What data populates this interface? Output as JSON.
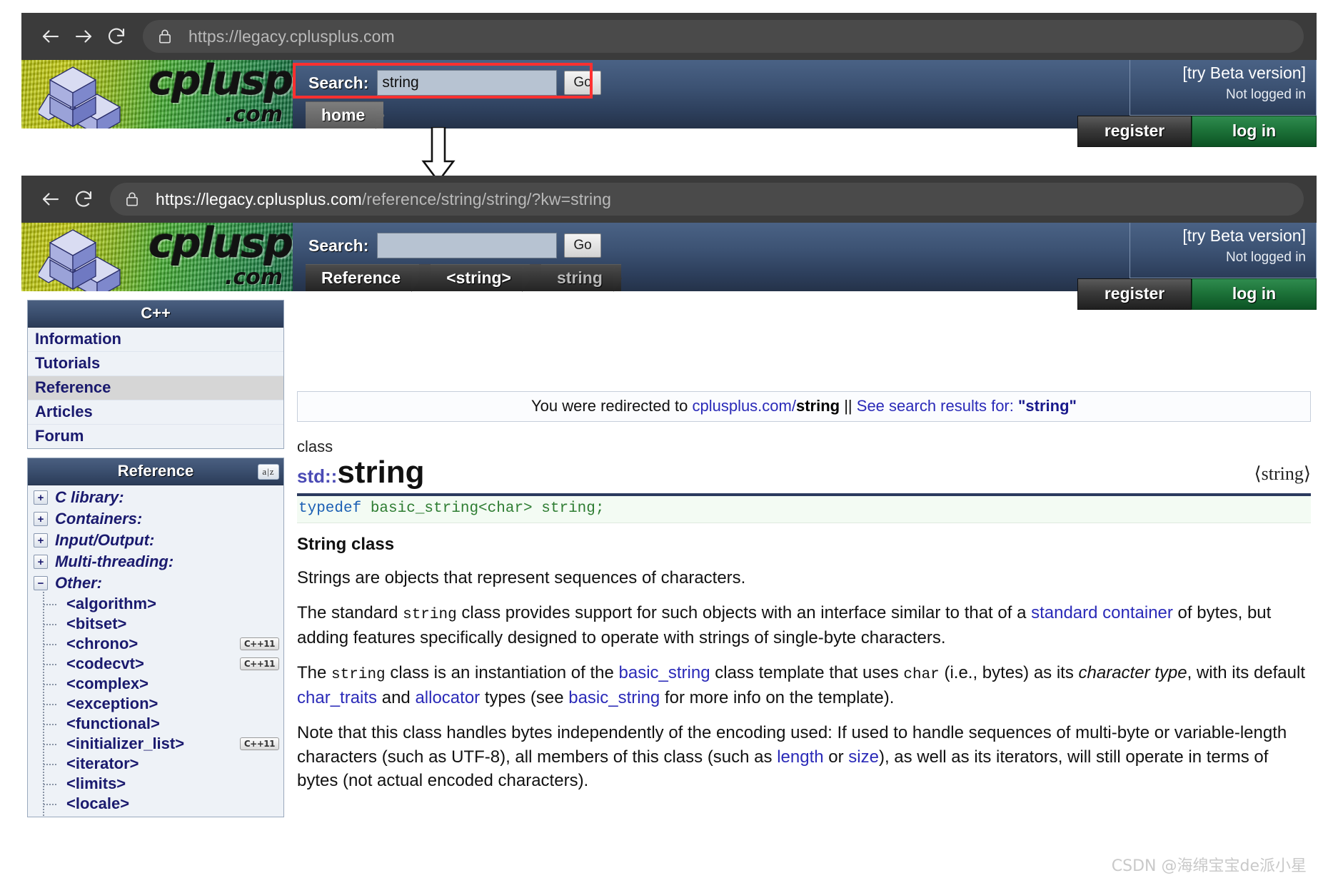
{
  "window_top": {
    "nav": {
      "back": "←",
      "forward": "→",
      "reload": "⟳",
      "lock_icon": "lock-icon"
    },
    "url_full": "https://legacy.cplusplus.com",
    "url_domain": "https://legacy.cplusplus.com",
    "url_path": "",
    "search_label": "Search:",
    "search_value": "string",
    "search_placeholder": "",
    "go_label": "Go",
    "beta_label": "[try Beta version]",
    "login_status": "Not logged in",
    "register_label": "register",
    "login_label": "log in",
    "logo_word": "cplusplus",
    "logo_dotcom": ".com",
    "crumb_home": "home"
  },
  "window_bottom": {
    "nav": {
      "back": "←",
      "reload": "⟳",
      "lock_icon": "lock-icon"
    },
    "url_domain": "https://legacy.cplusplus.com",
    "url_path": "/reference/string/string/?kw=string",
    "search_label": "Search:",
    "search_value": "",
    "search_placeholder": "",
    "go_label": "Go",
    "beta_label": "[try Beta version]",
    "login_status": "Not logged in",
    "register_label": "register",
    "login_label": "log in",
    "logo_word": "cplusplus",
    "logo_dotcom": ".com",
    "breadcrumbs": [
      "Reference",
      "<string>",
      "string"
    ]
  },
  "sidebar": {
    "cpp_panel_title": "C++",
    "cpp_menu": [
      {
        "label": "Information",
        "selected": false
      },
      {
        "label": "Tutorials",
        "selected": false
      },
      {
        "label": "Reference",
        "selected": true
      },
      {
        "label": "Articles",
        "selected": false
      },
      {
        "label": "Forum",
        "selected": false
      }
    ],
    "reference_panel_title": "Reference",
    "sort_icon_label": "a|z",
    "categories": [
      {
        "label": "C library:",
        "expanded": false,
        "toggle": "+"
      },
      {
        "label": "Containers:",
        "expanded": false,
        "toggle": "+"
      },
      {
        "label": "Input/Output:",
        "expanded": false,
        "toggle": "+"
      },
      {
        "label": "Multi-threading:",
        "expanded": false,
        "toggle": "+"
      },
      {
        "label": "Other:",
        "expanded": true,
        "toggle": "−"
      }
    ],
    "other_items": [
      {
        "label": "<algorithm>",
        "badge": ""
      },
      {
        "label": "<bitset>",
        "badge": ""
      },
      {
        "label": "<chrono>",
        "badge": "C++11"
      },
      {
        "label": "<codecvt>",
        "badge": "C++11"
      },
      {
        "label": "<complex>",
        "badge": ""
      },
      {
        "label": "<exception>",
        "badge": ""
      },
      {
        "label": "<functional>",
        "badge": ""
      },
      {
        "label": "<initializer_list>",
        "badge": "C++11"
      },
      {
        "label": "<iterator>",
        "badge": ""
      },
      {
        "label": "<limits>",
        "badge": ""
      },
      {
        "label": "<locale>",
        "badge": ""
      }
    ]
  },
  "article": {
    "redirect": {
      "prefix": "You were redirected to ",
      "link_text": "cplusplus.com/",
      "link_bold": "string",
      "separator": " || ",
      "see_text": "See search results for: ",
      "query": "\"string\""
    },
    "kind": "class",
    "namespace": "std::",
    "name": "string",
    "header_ref": "⟨string⟩",
    "typedef_code": "typedef basic_string<char> string;",
    "section_title": "String class",
    "paragraphs": [
      "Strings are objects that represent sequences of characters.",
      "The standard string class provides support for such objects with an interface similar to that of a standard container of bytes, but adding features specifically designed to operate with strings of single-byte characters.",
      "The string class is an instantiation of the basic_string class template that uses char (i.e., bytes) as its character type, with its default char_traits and allocator types (see basic_string for more info on the template).",
      "Note that this class handles bytes independently of the encoding used: If used to handle sequences of multi-byte or variable-length characters (such as UTF-8), all members of this class (such as length or size), as well as its iterators, will still operate in terms of bytes (not actual encoded characters)."
    ]
  },
  "watermark": "CSDN @海绵宝宝de派小星",
  "colors": {
    "chrome": "#3b3b3b",
    "header_blue": "#3c5273",
    "login_green": "#1d7339",
    "link": "#2a2ab8",
    "sidebar_text": "#1a1a6e",
    "highlight_red": "#ff3030"
  }
}
